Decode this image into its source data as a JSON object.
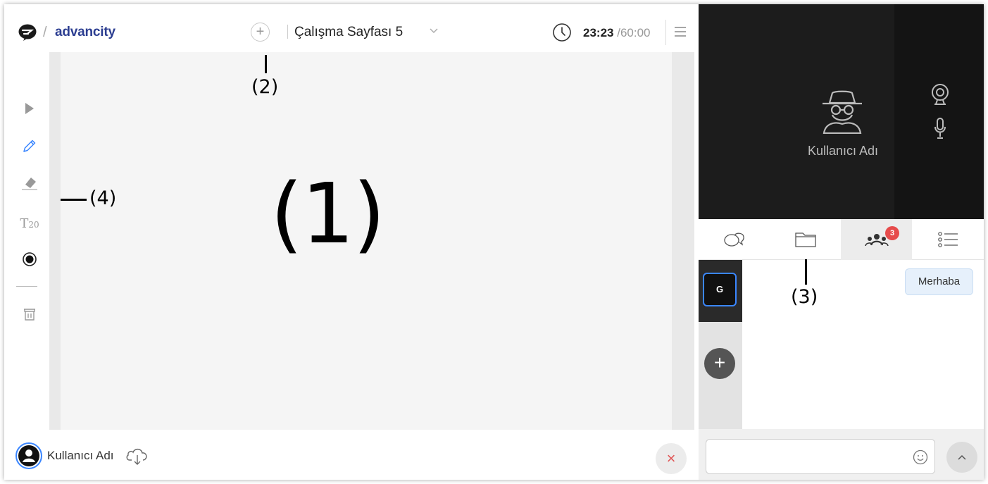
{
  "header": {
    "brand_separator": "/",
    "brand_name": "advancity",
    "add_page_symbol": "+",
    "page_title": "Çalışma Sayfası 5",
    "timer_elapsed": "23:23",
    "timer_separator": "/",
    "timer_total": "60:00"
  },
  "toolbar": {
    "tools": [
      "select-arrow-icon",
      "pencil-icon",
      "eraser-icon",
      "text-size-icon",
      "color-dot-icon",
      "trash-icon"
    ],
    "text_tool_label": "T",
    "text_tool_size": "20",
    "active_tool": "pencil",
    "accent_color": "#3a86ff"
  },
  "annotations": {
    "label_1": "(1)",
    "label_2": "(2)",
    "label_3": "(3)",
    "label_4": "(4)"
  },
  "footer": {
    "user_name": "Kullanıcı Adı",
    "close_symbol": "×"
  },
  "video": {
    "user_name": "Kullanıcı Adı"
  },
  "side_tabs": {
    "tabs": [
      "chat-icon",
      "folder-icon",
      "participants-icon",
      "list-icon"
    ],
    "active": "participants",
    "participants_badge": "3",
    "badge_color": "#e64b4b"
  },
  "participants": {
    "current_initial": "G",
    "add_symbol": "+"
  },
  "chat": {
    "message": "Merhaba",
    "input_value": ""
  }
}
